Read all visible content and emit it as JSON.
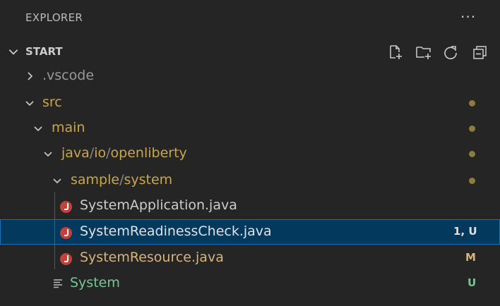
{
  "header": {
    "title": "EXPLORER",
    "more": "···"
  },
  "section": {
    "title": "START"
  },
  "tree": {
    "vscode": ".vscode",
    "src": "src",
    "main": "main",
    "path1": [
      "java",
      "/",
      "io",
      "/",
      "openliberty"
    ],
    "path2": [
      "sample",
      "/",
      "system"
    ],
    "files": [
      {
        "name": "SystemApplication.java",
        "badge": ""
      },
      {
        "name": "SystemReadinessCheck.java",
        "badge": "1, U"
      },
      {
        "name": "SystemResource.java",
        "badge": "M"
      }
    ],
    "system": {
      "name": "System",
      "badge": "U"
    }
  },
  "colors": {
    "background": "#252526",
    "folder": "#c9a646",
    "untracked": "#73c991",
    "modified": "#d7b57a",
    "selection": "#04395e",
    "java_icon": "#c4403b"
  }
}
